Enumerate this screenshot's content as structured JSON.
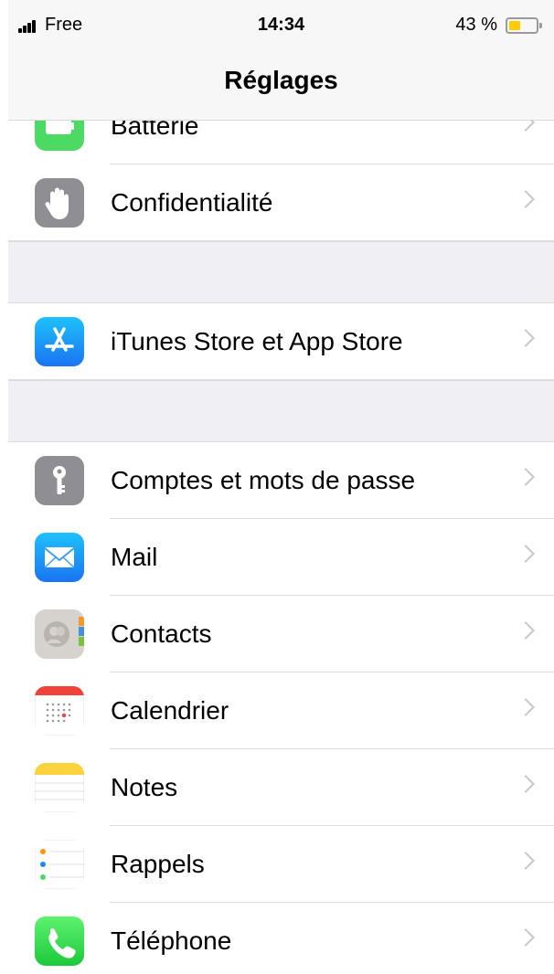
{
  "status_bar": {
    "carrier": "Free",
    "time": "14:34",
    "battery_percent": "43 %",
    "battery_level": 0.43
  },
  "nav": {
    "title": "Réglages"
  },
  "colors": {
    "battery_fill": "#ffcc00",
    "group_background": "#efeff4",
    "chevron": "#c7c7cc"
  },
  "groups": [
    {
      "items": [
        {
          "label": "Batterie",
          "icon": "battery-icon"
        },
        {
          "label": "Confidentialité",
          "icon": "hand-icon"
        }
      ]
    },
    {
      "items": [
        {
          "label": "iTunes Store et App Store",
          "icon": "app-store-icon"
        }
      ]
    },
    {
      "items": [
        {
          "label": "Comptes et mots de passe",
          "icon": "key-icon"
        },
        {
          "label": "Mail",
          "icon": "mail-icon"
        },
        {
          "label": "Contacts",
          "icon": "contacts-icon"
        },
        {
          "label": "Calendrier",
          "icon": "calendar-icon"
        },
        {
          "label": "Notes",
          "icon": "notes-icon"
        },
        {
          "label": "Rappels",
          "icon": "reminders-icon"
        },
        {
          "label": "Téléphone",
          "icon": "phone-icon"
        }
      ]
    }
  ]
}
